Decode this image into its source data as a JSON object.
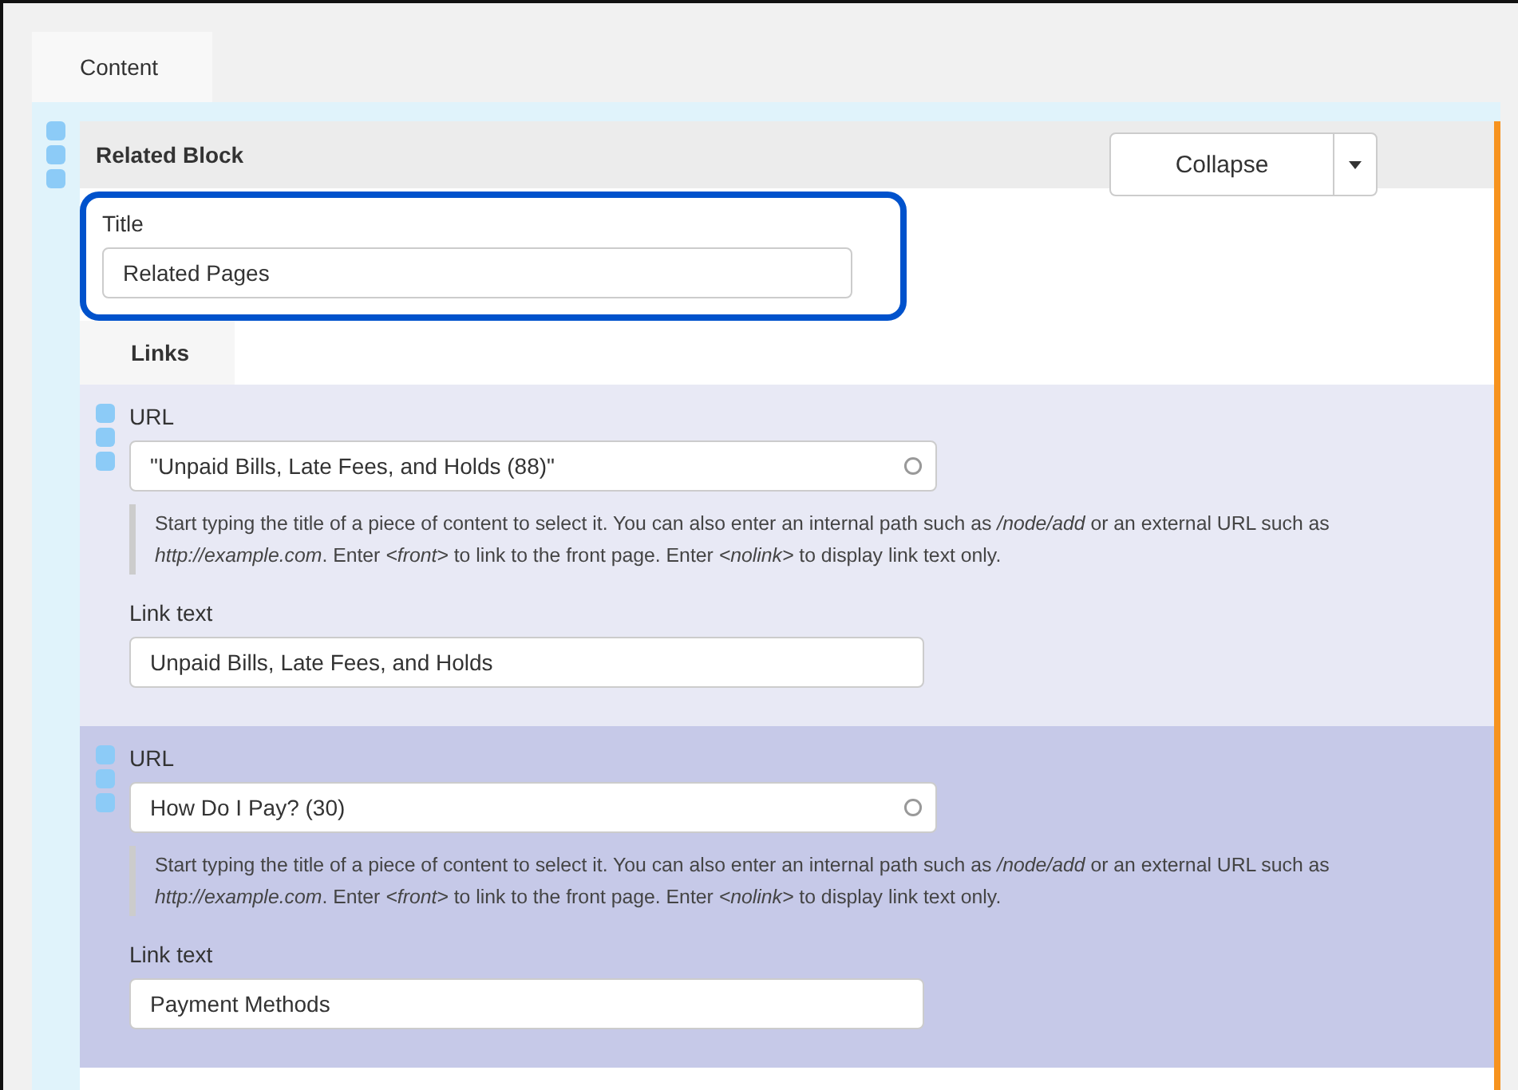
{
  "tabs": [
    {
      "label": "Content"
    }
  ],
  "block": {
    "title": "Related Block",
    "collapse_button": "Collapse",
    "title_field": {
      "label": "Title",
      "value": "Related Pages",
      "focused": true
    },
    "links_tab": {
      "label": "Links"
    },
    "links": [
      {
        "highlighted": false,
        "url_label": "URL",
        "url_value": "\"Unpaid Bills, Late Fees, and Holds (88)\"",
        "help": "Start typing the title of a piece of content to select it. You can also enter an internal path such as */node/add* or an external URL such as *http://example.com*. Enter *<front>* to link to the front page. Enter *<nolink>* to display link text only.",
        "text_label": "Link text",
        "text_value": "Unpaid Bills, Late Fees, and Holds"
      },
      {
        "highlighted": true,
        "url_label": "URL",
        "url_value": "How Do I Pay? (30)",
        "help": "Start typing the title of a piece of content to select it. You can also enter an internal path such as */node/add* or an external URL such as *http://example.com*. Enter *<front>* to link to the front page. Enter *<nolink>* to display link text only.",
        "text_label": "Link text",
        "text_value": "Payment Methods"
      }
    ]
  }
}
